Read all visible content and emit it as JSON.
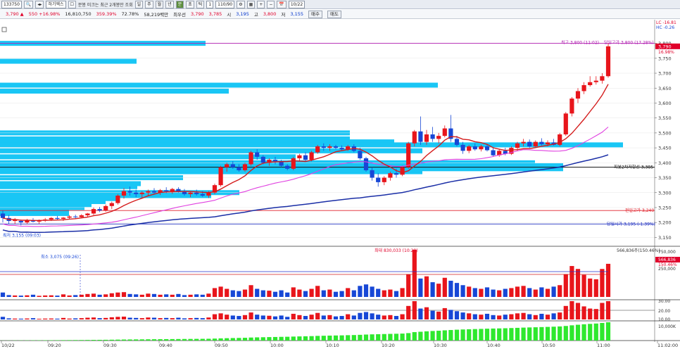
{
  "toolbar": {
    "code": "133750",
    "name": "하기엑스",
    "chk_label": "분봉 미크는 최근 2개봉만 조회",
    "period_buttons": [
      "일",
      "주",
      "월",
      "년",
      "분",
      "초",
      "틱"
    ],
    "active_period": "분",
    "interval": "1",
    "count": "110/90",
    "date": "10/22"
  },
  "info": {
    "price": "3,790 ▲",
    "change": "550 +16.98%",
    "volume": "16,810,750",
    "vol_ratio": "359.39%",
    "power": "72.78%",
    "amount": "58,219백만",
    "best_ask_label": "최우선",
    "best_ask": "3,790",
    "best_bid": "3,785",
    "open_label": "시",
    "open": "3,195",
    "high_label": "고",
    "high": "3,800",
    "low_label": "저",
    "low": "3,155",
    "buy_btn": "매수",
    "sell_btn": "매도"
  },
  "annotations": {
    "lc": "LC -16.81",
    "hc": "HC -0.26",
    "current_price_tag": "3,790",
    "current_pct": "16.98%",
    "high_label": "최고 3,800 (11:02)",
    "day_high_label": "당일고가 3,800 (17.28%)",
    "low_label": "최저 3,155 (09:03)",
    "pivot_label": "피봇2차저항선 3,385",
    "prev_high_label": "전일고가 3,240",
    "day_open_label": "당일시가 3,195 (-1.39%)",
    "vol_max_label": "최대 830,033 (10:29)",
    "vol_min_label": "최소 3,075 (09:26)",
    "vol_right_label": "566,836주(150.46%)",
    "vol_current_tag": "566,836",
    "vol_current_pct": "150.46%"
  },
  "colors": {
    "up": "#e8151b",
    "down": "#1747d6",
    "ma5": "#d41c1c",
    "ma20": "#e040e0",
    "ma60": "#1a2ea6",
    "profile": "#19c6f5",
    "hline_high": "#b01db0",
    "hline_prev": "#e0202a",
    "hline_open": "#2030c0",
    "vol_green": "#2ee82e"
  },
  "chart_data": {
    "type": "candlestick",
    "ylim": [
      3125,
      3825
    ],
    "price_ticks": [
      3800,
      3750,
      3700,
      3650,
      3600,
      3550,
      3500,
      3450,
      3400,
      3350,
      3300,
      3250,
      3200,
      3150
    ],
    "price_tick_labels": [
      "3,800",
      "3,750",
      "3,700",
      "3,650",
      "3,600",
      "3,550",
      "3,500",
      "3,450",
      "3,400",
      "3,350",
      "3,300",
      "3,250",
      "3,200",
      "3,150"
    ],
    "time_labels": [
      "10/22",
      "09:20",
      "09:30",
      "09:40",
      "09:50",
      "10:00",
      "10:10",
      "10:20",
      "10:30",
      "10:40",
      "10:50",
      "11:00",
      "11:02:00"
    ],
    "vol_ticks": [
      "750,000",
      "500,000",
      "250,000"
    ],
    "ind1_ticks": [
      "30.00",
      "20.00",
      "10.00"
    ],
    "ind2_ticks": [
      "10,000K"
    ],
    "horizontal_lines": {
      "day_high": 3800,
      "pivot2": 3385,
      "prev_high": 3240,
      "day_open": 3195
    },
    "candles": [
      [
        3230,
        3240,
        3200,
        3215
      ],
      [
        3215,
        3225,
        3195,
        3205
      ],
      [
        3205,
        3215,
        3195,
        3210
      ],
      [
        3205,
        3210,
        3190,
        3200
      ],
      [
        3200,
        3212,
        3195,
        3208
      ],
      [
        3208,
        3215,
        3200,
        3203
      ],
      [
        3203,
        3210,
        3195,
        3207
      ],
      [
        3207,
        3215,
        3202,
        3210
      ],
      [
        3210,
        3218,
        3205,
        3215
      ],
      [
        3215,
        3222,
        3208,
        3212
      ],
      [
        3212,
        3218,
        3205,
        3216
      ],
      [
        3216,
        3225,
        3210,
        3220
      ],
      [
        3220,
        3226,
        3212,
        3218
      ],
      [
        3218,
        3228,
        3214,
        3224
      ],
      [
        3224,
        3232,
        3218,
        3230
      ],
      [
        3230,
        3250,
        3225,
        3245
      ],
      [
        3245,
        3252,
        3235,
        3240
      ],
      [
        3240,
        3260,
        3236,
        3255
      ],
      [
        3255,
        3270,
        3245,
        3265
      ],
      [
        3265,
        3295,
        3260,
        3290
      ],
      [
        3290,
        3315,
        3280,
        3305
      ],
      [
        3305,
        3320,
        3290,
        3300
      ],
      [
        3300,
        3310,
        3285,
        3295
      ],
      [
        3295,
        3305,
        3282,
        3300
      ],
      [
        3300,
        3310,
        3290,
        3305
      ],
      [
        3305,
        3315,
        3295,
        3300
      ],
      [
        3300,
        3312,
        3292,
        3308
      ],
      [
        3308,
        3318,
        3298,
        3304
      ],
      [
        3304,
        3316,
        3296,
        3312
      ],
      [
        3312,
        3318,
        3300,
        3305
      ],
      [
        3305,
        3312,
        3290,
        3295
      ],
      [
        3295,
        3305,
        3285,
        3300
      ],
      [
        3300,
        3310,
        3290,
        3295
      ],
      [
        3295,
        3305,
        3286,
        3290
      ],
      [
        3290,
        3305,
        3282,
        3300
      ],
      [
        3300,
        3330,
        3295,
        3325
      ],
      [
        3325,
        3390,
        3320,
        3385
      ],
      [
        3385,
        3400,
        3370,
        3395
      ],
      [
        3395,
        3405,
        3380,
        3385
      ],
      [
        3385,
        3395,
        3370,
        3375
      ],
      [
        3375,
        3400,
        3370,
        3395
      ],
      [
        3395,
        3440,
        3390,
        3435
      ],
      [
        3435,
        3445,
        3410,
        3420
      ],
      [
        3420,
        3425,
        3395,
        3400
      ],
      [
        3400,
        3415,
        3390,
        3410
      ],
      [
        3410,
        3420,
        3395,
        3405
      ],
      [
        3405,
        3410,
        3385,
        3390
      ],
      [
        3390,
        3395,
        3375,
        3380
      ],
      [
        3380,
        3420,
        3375,
        3415
      ],
      [
        3415,
        3430,
        3405,
        3425
      ],
      [
        3425,
        3435,
        3405,
        3410
      ],
      [
        3410,
        3440,
        3405,
        3435
      ],
      [
        3435,
        3460,
        3430,
        3455
      ],
      [
        3455,
        3465,
        3440,
        3450
      ],
      [
        3450,
        3462,
        3440,
        3455
      ],
      [
        3455,
        3460,
        3445,
        3450
      ],
      [
        3450,
        3458,
        3440,
        3445
      ],
      [
        3445,
        3460,
        3440,
        3455
      ],
      [
        3455,
        3462,
        3435,
        3440
      ],
      [
        3440,
        3450,
        3410,
        3415
      ],
      [
        3415,
        3420,
        3370,
        3375
      ],
      [
        3375,
        3385,
        3340,
        3350
      ],
      [
        3350,
        3365,
        3320,
        3335
      ],
      [
        3335,
        3355,
        3325,
        3350
      ],
      [
        3350,
        3370,
        3340,
        3365
      ],
      [
        3365,
        3380,
        3350,
        3360
      ],
      [
        3360,
        3390,
        3355,
        3385
      ],
      [
        3385,
        3470,
        3380,
        3465
      ],
      [
        3465,
        3510,
        3455,
        3505
      ],
      [
        3505,
        3555,
        3460,
        3470
      ],
      [
        3470,
        3510,
        3460,
        3495
      ],
      [
        3495,
        3520,
        3470,
        3480
      ],
      [
        3480,
        3500,
        3465,
        3490
      ],
      [
        3490,
        3525,
        3485,
        3515
      ],
      [
        3515,
        3560,
        3470,
        3480
      ],
      [
        3480,
        3490,
        3455,
        3460
      ],
      [
        3460,
        3470,
        3430,
        3440
      ],
      [
        3440,
        3460,
        3432,
        3455
      ],
      [
        3455,
        3465,
        3440,
        3445
      ],
      [
        3445,
        3460,
        3438,
        3455
      ],
      [
        3455,
        3462,
        3438,
        3442
      ],
      [
        3442,
        3450,
        3420,
        3425
      ],
      [
        3425,
        3445,
        3420,
        3440
      ],
      [
        3440,
        3450,
        3425,
        3430
      ],
      [
        3430,
        3455,
        3426,
        3450
      ],
      [
        3450,
        3470,
        3440,
        3465
      ],
      [
        3465,
        3480,
        3455,
        3470
      ],
      [
        3470,
        3478,
        3450,
        3455
      ],
      [
        3455,
        3475,
        3450,
        3470
      ],
      [
        3470,
        3482,
        3458,
        3462
      ],
      [
        3462,
        3475,
        3455,
        3468
      ],
      [
        3468,
        3480,
        3458,
        3460
      ],
      [
        3460,
        3500,
        3455,
        3495
      ],
      [
        3495,
        3570,
        3490,
        3565
      ],
      [
        3565,
        3620,
        3555,
        3615
      ],
      [
        3615,
        3650,
        3600,
        3640
      ],
      [
        3640,
        3670,
        3630,
        3660
      ],
      [
        3660,
        3690,
        3655,
        3670
      ],
      [
        3670,
        3690,
        3662,
        3675
      ],
      [
        3675,
        3700,
        3665,
        3690
      ],
      [
        3690,
        3800,
        3685,
        3790
      ]
    ],
    "volumes": [
      60,
      25,
      20,
      18,
      22,
      30,
      15,
      20,
      22,
      18,
      35,
      20,
      25,
      30,
      40,
      45,
      30,
      35,
      50,
      60,
      65,
      40,
      35,
      30,
      45,
      40,
      30,
      35,
      30,
      40,
      25,
      30,
      35,
      30,
      45,
      120,
      140,
      110,
      90,
      80,
      100,
      160,
      110,
      90,
      85,
      70,
      90,
      60,
      130,
      100,
      80,
      110,
      150,
      90,
      100,
      70,
      80,
      120,
      90,
      150,
      170,
      140,
      110,
      90,
      100,
      80,
      120,
      310,
      640,
      250,
      280,
      200,
      180,
      260,
      220,
      190,
      160,
      140,
      120,
      110,
      130,
      100,
      90,
      110,
      120,
      140,
      150,
      120,
      100,
      130,
      110,
      140,
      160,
      310,
      420,
      380,
      300,
      250,
      240,
      380,
      450
    ]
  }
}
